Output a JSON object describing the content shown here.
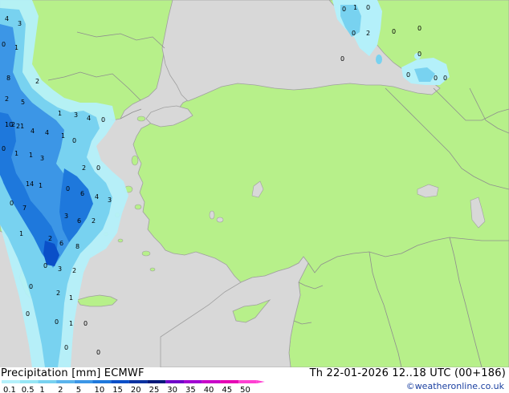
{
  "footer": {
    "title_left": "Precipitation [mm]  ECMWF",
    "title_right": "Th 22-01-2026 12..18 UTC (00+186)",
    "credit": "©weatheronline.co.uk"
  },
  "colors": {
    "sea": "#d8d8d8",
    "land": "#b7f08a",
    "border": "#8e8e8e",
    "coast": "#a0a0a0"
  },
  "legend": {
    "ticks": [
      "0.1",
      "0.5",
      "1",
      "2",
      "5",
      "10",
      "15",
      "20",
      "25",
      "30",
      "35",
      "40",
      "45",
      "50"
    ],
    "colors": [
      "#b4f0fa",
      "#96e6f5",
      "#78d2f0",
      "#5ab4ec",
      "#3c96e6",
      "#1e78dc",
      "#0a4fc8",
      "#0a32a0",
      "#00187a",
      "#6e00c8",
      "#a000d2",
      "#c800c8",
      "#e600b4",
      "#ff40d2"
    ]
  },
  "precip_labels": [
    {
      "v": "4"
    },
    {
      "v": "3"
    },
    {
      "v": "0"
    },
    {
      "v": "1"
    },
    {
      "v": "8"
    },
    {
      "v": "2"
    },
    {
      "v": "2"
    },
    {
      "v": "5"
    },
    {
      "v": "2"
    },
    {
      "v": "10"
    },
    {
      "v": "21"
    },
    {
      "v": "4"
    },
    {
      "v": "4"
    },
    {
      "v": "1"
    },
    {
      "v": "3"
    },
    {
      "v": "4"
    },
    {
      "v": "0"
    },
    {
      "v": "0"
    },
    {
      "v": "1"
    },
    {
      "v": "0"
    },
    {
      "v": "3"
    },
    {
      "v": "1"
    },
    {
      "v": "1"
    },
    {
      "v": "14"
    },
    {
      "v": "0"
    },
    {
      "v": "2"
    },
    {
      "v": "1"
    },
    {
      "v": "0"
    },
    {
      "v": "6"
    },
    {
      "v": "4"
    },
    {
      "v": "3"
    },
    {
      "v": "0"
    },
    {
      "v": "7"
    },
    {
      "v": "3"
    },
    {
      "v": "6"
    },
    {
      "v": "2"
    },
    {
      "v": "1"
    },
    {
      "v": "2"
    },
    {
      "v": "6"
    },
    {
      "v": "8"
    },
    {
      "v": "0"
    },
    {
      "v": "3"
    },
    {
      "v": "2"
    },
    {
      "v": "0"
    },
    {
      "v": "2"
    },
    {
      "v": "1"
    },
    {
      "v": "0"
    },
    {
      "v": "0"
    },
    {
      "v": "1"
    },
    {
      "v": "0"
    },
    {
      "v": "0"
    },
    {
      "v": "0"
    },
    {
      "v": "0"
    },
    {
      "v": "1"
    },
    {
      "v": "0"
    },
    {
      "v": "0"
    },
    {
      "v": "0"
    },
    {
      "v": "2"
    },
    {
      "v": "0"
    },
    {
      "v": "0"
    },
    {
      "v": "0"
    },
    {
      "v": "0"
    },
    {
      "v": "0"
    },
    {
      "v": "0"
    }
  ]
}
